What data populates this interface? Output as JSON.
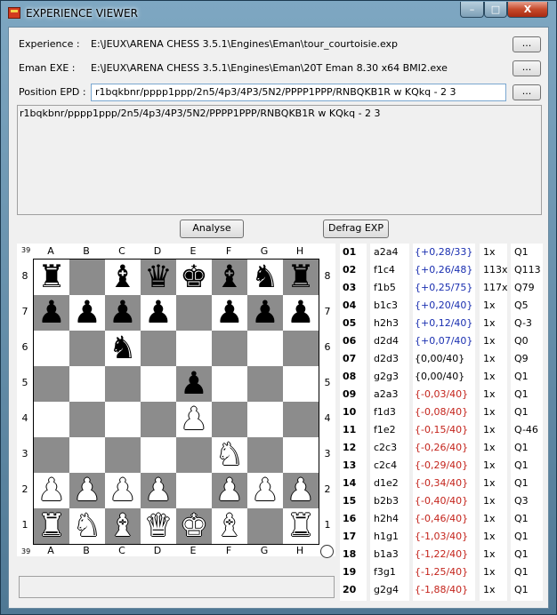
{
  "window": {
    "title": "EXPERIENCE VIEWER",
    "min_glyph": "–",
    "max_glyph": "□",
    "close_glyph": "X"
  },
  "fields": {
    "experience": {
      "label": "Experience :",
      "value": "E:\\JEUX\\ARENA CHESS 3.5.1\\Engines\\Eman\\tour_courtoisie.exp",
      "browse": "..."
    },
    "engine": {
      "label": "Eman EXE :",
      "value": "E:\\JEUX\\ARENA CHESS 3.5.1\\Engines\\Eman\\20T Eman 8.30 x64 BMI2.exe",
      "browse": "..."
    },
    "epd": {
      "label": "Position EPD :",
      "value": "r1bqkbnr/pppp1ppp/2n5/4p3/4P3/5N2/PPPP1PPP/RNBQKB1R w KQkq - 2 3",
      "browse": "..."
    }
  },
  "output_text": "r1bqkbnr/pppp1ppp/2n5/4p3/4P3/5N2/PPPP1PPP/RNBQKB1R w KQkq - 2 3",
  "buttons": {
    "analyse": "Analyse",
    "defrag": "Defrag EXP"
  },
  "board": {
    "corner_top": "39",
    "corner_bottom": "39",
    "files": [
      "A",
      "B",
      "C",
      "D",
      "E",
      "F",
      "G",
      "H"
    ],
    "ranks": [
      "8",
      "7",
      "6",
      "5",
      "4",
      "3",
      "2",
      "1"
    ],
    "position_fen": "r1bqkbnr/pppp1ppp/2n5/4p3/4P3/5N2/PPPP1PPP/RNBQKB1R",
    "pieces": [
      {
        "square": "a8",
        "piece": "♜",
        "color": "b",
        "name": "black-rook-icon"
      },
      {
        "square": "c8",
        "piece": "♝",
        "color": "b",
        "name": "black-bishop-icon"
      },
      {
        "square": "d8",
        "piece": "♛",
        "color": "b",
        "name": "black-queen-icon"
      },
      {
        "square": "e8",
        "piece": "♚",
        "color": "b",
        "name": "black-king-icon"
      },
      {
        "square": "f8",
        "piece": "♝",
        "color": "b",
        "name": "black-bishop-icon"
      },
      {
        "square": "g8",
        "piece": "♞",
        "color": "b",
        "name": "black-knight-icon"
      },
      {
        "square": "h8",
        "piece": "♜",
        "color": "b",
        "name": "black-rook-icon"
      },
      {
        "square": "a7",
        "piece": "♟",
        "color": "b",
        "name": "black-pawn-icon"
      },
      {
        "square": "b7",
        "piece": "♟",
        "color": "b",
        "name": "black-pawn-icon"
      },
      {
        "square": "c7",
        "piece": "♟",
        "color": "b",
        "name": "black-pawn-icon"
      },
      {
        "square": "d7",
        "piece": "♟",
        "color": "b",
        "name": "black-pawn-icon"
      },
      {
        "square": "f7",
        "piece": "♟",
        "color": "b",
        "name": "black-pawn-icon"
      },
      {
        "square": "g7",
        "piece": "♟",
        "color": "b",
        "name": "black-pawn-icon"
      },
      {
        "square": "h7",
        "piece": "♟",
        "color": "b",
        "name": "black-pawn-icon"
      },
      {
        "square": "c6",
        "piece": "♞",
        "color": "b",
        "name": "black-knight-icon"
      },
      {
        "square": "e5",
        "piece": "♟",
        "color": "b",
        "name": "black-pawn-icon"
      },
      {
        "square": "e4",
        "piece": "♟",
        "color": "w",
        "name": "white-pawn-icon"
      },
      {
        "square": "f3",
        "piece": "♞",
        "color": "w",
        "name": "white-knight-icon"
      },
      {
        "square": "a2",
        "piece": "♟",
        "color": "w",
        "name": "white-pawn-icon"
      },
      {
        "square": "b2",
        "piece": "♟",
        "color": "w",
        "name": "white-pawn-icon"
      },
      {
        "square": "c2",
        "piece": "♟",
        "color": "w",
        "name": "white-pawn-icon"
      },
      {
        "square": "d2",
        "piece": "♟",
        "color": "w",
        "name": "white-pawn-icon"
      },
      {
        "square": "f2",
        "piece": "♟",
        "color": "w",
        "name": "white-pawn-icon"
      },
      {
        "square": "g2",
        "piece": "♟",
        "color": "w",
        "name": "white-pawn-icon"
      },
      {
        "square": "h2",
        "piece": "♟",
        "color": "w",
        "name": "white-pawn-icon"
      },
      {
        "square": "a1",
        "piece": "♜",
        "color": "w",
        "name": "white-rook-icon"
      },
      {
        "square": "b1",
        "piece": "♞",
        "color": "w",
        "name": "white-knight-icon"
      },
      {
        "square": "c1",
        "piece": "♝",
        "color": "w",
        "name": "white-bishop-icon"
      },
      {
        "square": "d1",
        "piece": "♛",
        "color": "w",
        "name": "white-queen-icon"
      },
      {
        "square": "e1",
        "piece": "♚",
        "color": "w",
        "name": "white-king-icon"
      },
      {
        "square": "f1",
        "piece": "♝",
        "color": "w",
        "name": "white-bishop-icon"
      },
      {
        "square": "h1",
        "piece": "♜",
        "color": "w",
        "name": "white-rook-icon"
      }
    ]
  },
  "moves": [
    {
      "num": "01",
      "move": "a2a4",
      "score": "{+0,28/33}",
      "tone": "pos",
      "count": "1x",
      "q": "Q1"
    },
    {
      "num": "02",
      "move": "f1c4",
      "score": "{+0,26/48}",
      "tone": "pos",
      "count": "113x",
      "q": "Q113"
    },
    {
      "num": "03",
      "move": "f1b5",
      "score": "{+0,25/75}",
      "tone": "pos",
      "count": "117x",
      "q": "Q79"
    },
    {
      "num": "04",
      "move": "b1c3",
      "score": "{+0,20/40}",
      "tone": "pos",
      "count": "1x",
      "q": "Q5"
    },
    {
      "num": "05",
      "move": "h2h3",
      "score": "{+0,12/40}",
      "tone": "pos",
      "count": "1x",
      "q": "Q-3"
    },
    {
      "num": "06",
      "move": "d2d4",
      "score": "{+0,07/40}",
      "tone": "pos",
      "count": "1x",
      "q": "Q0"
    },
    {
      "num": "07",
      "move": "d2d3",
      "score": "{0,00/40}",
      "tone": "neu",
      "count": "1x",
      "q": "Q9"
    },
    {
      "num": "08",
      "move": "g2g3",
      "score": "{0,00/40}",
      "tone": "neu",
      "count": "1x",
      "q": "Q1"
    },
    {
      "num": "09",
      "move": "a2a3",
      "score": "{-0,03/40}",
      "tone": "neg",
      "count": "1x",
      "q": "Q1"
    },
    {
      "num": "10",
      "move": "f1d3",
      "score": "{-0,08/40}",
      "tone": "neg",
      "count": "1x",
      "q": "Q1"
    },
    {
      "num": "11",
      "move": "f1e2",
      "score": "{-0,15/40}",
      "tone": "neg",
      "count": "1x",
      "q": "Q-46"
    },
    {
      "num": "12",
      "move": "c2c3",
      "score": "{-0,26/40}",
      "tone": "neg",
      "count": "1x",
      "q": "Q1"
    },
    {
      "num": "13",
      "move": "c2c4",
      "score": "{-0,29/40}",
      "tone": "neg",
      "count": "1x",
      "q": "Q1"
    },
    {
      "num": "14",
      "move": "d1e2",
      "score": "{-0,34/40}",
      "tone": "neg",
      "count": "1x",
      "q": "Q1"
    },
    {
      "num": "15",
      "move": "b2b3",
      "score": "{-0,40/40}",
      "tone": "neg",
      "count": "1x",
      "q": "Q3"
    },
    {
      "num": "16",
      "move": "h2h4",
      "score": "{-0,46/40}",
      "tone": "neg",
      "count": "1x",
      "q": "Q1"
    },
    {
      "num": "17",
      "move": "h1g1",
      "score": "{-1,03/40}",
      "tone": "neg",
      "count": "1x",
      "q": "Q1"
    },
    {
      "num": "18",
      "move": "b1a3",
      "score": "{-1,22/40}",
      "tone": "neg",
      "count": "1x",
      "q": "Q1"
    },
    {
      "num": "19",
      "move": "f3g1",
      "score": "{-1,25/40}",
      "tone": "neg",
      "count": "1x",
      "q": "Q1"
    },
    {
      "num": "20",
      "move": "g2g4",
      "score": "{-1,88/40}",
      "tone": "neg",
      "count": "1x",
      "q": "Q1"
    }
  ],
  "colors": {
    "positive_score": "#1a2fb0",
    "negative_score": "#c4241c",
    "dark_square": "#8c8c8c",
    "light_square": "#ffffff"
  }
}
